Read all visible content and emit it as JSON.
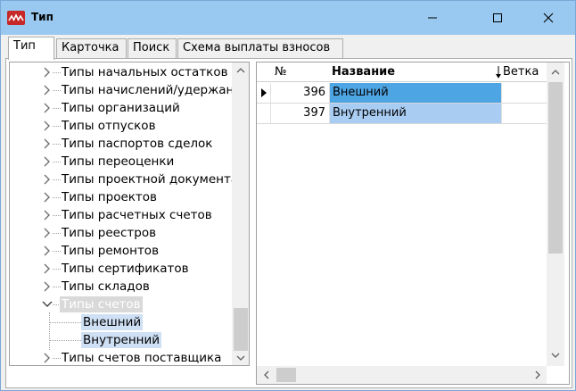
{
  "window": {
    "title": "Тип"
  },
  "tabs": [
    {
      "label": "Тип",
      "active": true
    },
    {
      "label": "Карточка",
      "active": false
    },
    {
      "label": "Поиск",
      "active": false
    },
    {
      "label": "Схема выплаты взносов",
      "active": false
    }
  ],
  "tree": {
    "items": [
      {
        "label": "Типы начальных остатков",
        "state": "collapsed"
      },
      {
        "label": "Типы начислений/удержаний",
        "state": "collapsed"
      },
      {
        "label": "Типы организаций",
        "state": "collapsed"
      },
      {
        "label": "Типы отпусков",
        "state": "collapsed"
      },
      {
        "label": "Типы паспортов сделок",
        "state": "collapsed"
      },
      {
        "label": "Типы переоценки",
        "state": "collapsed"
      },
      {
        "label": "Типы проектной документации",
        "state": "collapsed"
      },
      {
        "label": "Типы проектов",
        "state": "collapsed"
      },
      {
        "label": "Типы расчетных счетов",
        "state": "collapsed"
      },
      {
        "label": "Типы реестров",
        "state": "collapsed"
      },
      {
        "label": "Типы ремонтов",
        "state": "collapsed"
      },
      {
        "label": "Типы сертификатов",
        "state": "collapsed"
      },
      {
        "label": "Типы складов",
        "state": "collapsed"
      },
      {
        "label": "Типы счетов",
        "state": "expanded",
        "selected": true
      },
      {
        "label": "Внешний",
        "state": "leaf",
        "child": true
      },
      {
        "label": "Внутренний",
        "state": "leaf",
        "child": true
      },
      {
        "label": "Типы счетов поставщика",
        "state": "collapsed"
      }
    ]
  },
  "grid": {
    "columns": {
      "num": "№",
      "name": "Название",
      "branch": "Ветка"
    },
    "rows": [
      {
        "num": "396",
        "name": "Внешний",
        "branch": "",
        "current": true
      },
      {
        "num": "397",
        "name": "Внутренний",
        "branch": "",
        "current": false
      }
    ]
  },
  "colors": {
    "titlebar": "#99c9f0",
    "selected_cell": "#4ea5e3",
    "selected_row_light": "#a9cdf2"
  }
}
